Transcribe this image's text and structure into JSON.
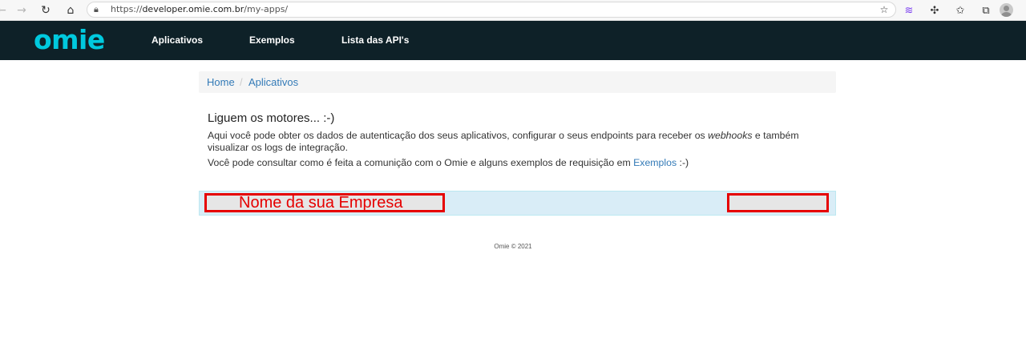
{
  "browser": {
    "url_prefix": "https://",
    "url_host": "developer.omie.com.br",
    "url_path": "/my-apps/",
    "back_icon": "back-arrow-icon",
    "forward_icon": "forward-arrow-icon",
    "refresh_icon": "refresh-icon",
    "home_icon": "home-icon"
  },
  "nav": {
    "logo": "omie",
    "links": [
      "Aplicativos",
      "Exemplos",
      "Lista das API's"
    ]
  },
  "breadcrumb": {
    "home": "Home",
    "separator": "/",
    "current": "Aplicativos"
  },
  "intro": {
    "title": "Liguem os motores... :-)",
    "line1_a": "Aqui você pode obter os dados de autenticação dos seus aplicativos, configurar o seus endpoints para receber os ",
    "line1_em": "webhooks",
    "line1_b": " e também",
    "line2": "visualizar os logs de integração.",
    "line3_a": "Você pode consultar como é feita a comunição com o Omie e alguns exemplos de requisição em ",
    "line3_link": "Exemplos",
    "line3_b": " :-)"
  },
  "app_row": {
    "company_name": "Nome da sua Empresa"
  },
  "footer": {
    "text": "Omie © 2021"
  },
  "colors": {
    "navbar": "#0e2128",
    "logo": "#00c9de",
    "link": "#337ab7",
    "row_bg": "#d9edf7",
    "highlight": "#e60000"
  }
}
